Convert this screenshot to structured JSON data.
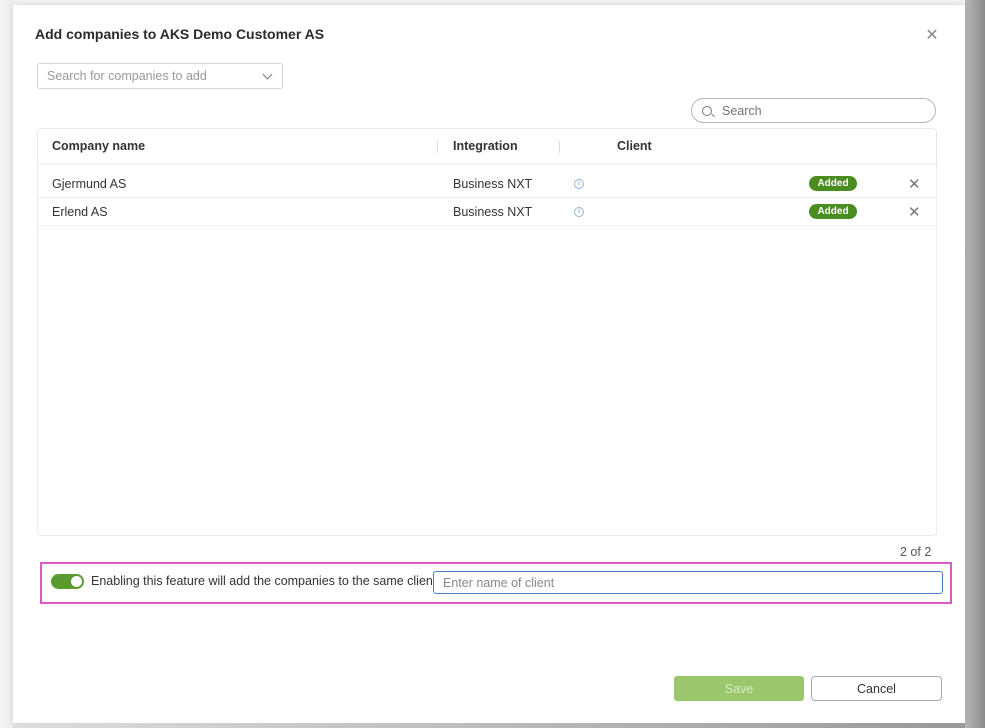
{
  "dialog": {
    "title": "Add companies to AKS Demo Customer AS",
    "close_icon": "close-icon"
  },
  "company_select": {
    "placeholder": "Search for companies to add",
    "icon": "chevron-down-icon"
  },
  "search": {
    "placeholder": "Search",
    "icon": "search-icon"
  },
  "table": {
    "columns": [
      "Company name",
      "Integration",
      "Client"
    ],
    "rows": [
      {
        "company": "Gjermund AS",
        "integration": "Business NXT",
        "client_icon": "info-icon",
        "status": "Added",
        "remove_icon": "close-icon"
      },
      {
        "company": "Erlend AS",
        "integration": "Business NXT",
        "client_icon": "info-icon",
        "status": "Added",
        "remove_icon": "close-icon"
      }
    ],
    "pager": "2 of 2"
  },
  "same_client": {
    "enabled": true,
    "label": "Enabling this feature will add the companies to the same client",
    "input_placeholder": "Enter name of client",
    "input_value": ""
  },
  "footer": {
    "save_label": "Save",
    "cancel_label": "Cancel"
  },
  "colors": {
    "accent_green": "#5b9a2e",
    "badge_green": "#4b8c21",
    "save_disabled": "#9bc66b",
    "highlight": "#d85bc6",
    "input_focus": "#4a7fd0"
  }
}
